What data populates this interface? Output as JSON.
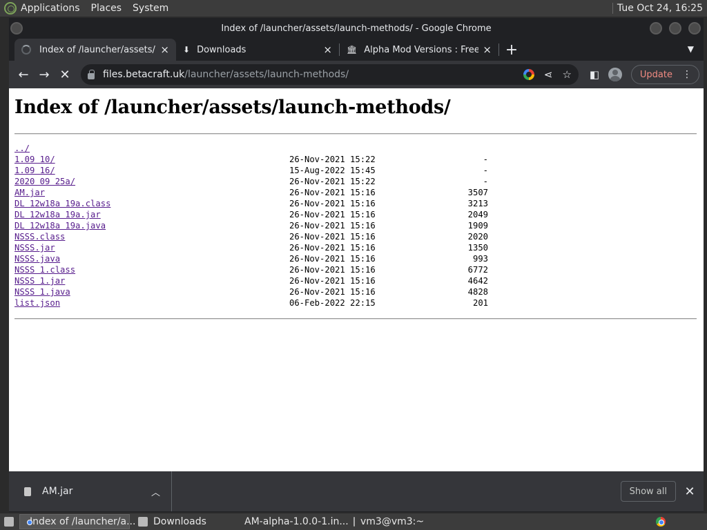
{
  "top_panel": {
    "menus": [
      "Applications",
      "Places",
      "System"
    ],
    "clock": "Tue Oct 24, 16:25"
  },
  "window": {
    "title": "Index of /launcher/assets/launch-methods/ - Google Chrome"
  },
  "tabs": [
    {
      "title": "Index of /launcher/assets/launch-methods/",
      "close": "×"
    },
    {
      "title": "Downloads",
      "close": "×"
    },
    {
      "title": "Alpha Mod Versions : Free Download",
      "close": "×"
    }
  ],
  "new_tab": "+",
  "address_bar": {
    "host": "files.betacraft.uk",
    "path": "/launcher/assets/launch-methods/"
  },
  "update_button": "Update",
  "page": {
    "heading": "Index of /launcher/assets/launch-methods/",
    "parent_link": "../",
    "entries": [
      {
        "name": "1.09 10/",
        "date": "26-Nov-2021 15:22",
        "size": "-"
      },
      {
        "name": "1.09 16/",
        "date": "15-Aug-2022 15:45",
        "size": "-"
      },
      {
        "name": "2020 09 25a/",
        "date": "26-Nov-2021 15:22",
        "size": "-"
      },
      {
        "name": "AM.jar",
        "date": "26-Nov-2021 15:16",
        "size": "3507"
      },
      {
        "name": "DL 12w18a 19a.class",
        "date": "26-Nov-2021 15:16",
        "size": "3213"
      },
      {
        "name": "DL 12w18a 19a.jar",
        "date": "26-Nov-2021 15:16",
        "size": "2049"
      },
      {
        "name": "DL 12w18a 19a.java",
        "date": "26-Nov-2021 15:16",
        "size": "1909"
      },
      {
        "name": "NSSS.class",
        "date": "26-Nov-2021 15:16",
        "size": "2020"
      },
      {
        "name": "NSSS.jar",
        "date": "26-Nov-2021 15:16",
        "size": "1350"
      },
      {
        "name": "NSSS.java",
        "date": "26-Nov-2021 15:16",
        "size": "993"
      },
      {
        "name": "NSSS 1.class",
        "date": "26-Nov-2021 15:16",
        "size": "6772"
      },
      {
        "name": "NSSS 1.jar",
        "date": "26-Nov-2021 15:16",
        "size": "4642"
      },
      {
        "name": "NSSS 1.java",
        "date": "26-Nov-2021 15:16",
        "size": "4828"
      },
      {
        "name": "list.json",
        "date": "06-Feb-2022 22:15",
        "size": "201"
      }
    ]
  },
  "download_shelf": {
    "file_name": "AM.jar",
    "show_all": "Show all"
  },
  "taskbar": [
    {
      "label": "Index of /launcher/a...",
      "icon": "chrome-icon",
      "active": true
    },
    {
      "label": "Downloads",
      "icon": "folder-icon",
      "active": false
    },
    {
      "label": "AM-alpha-1.0.0-1.in...",
      "icon": "text-editor-icon",
      "active": false
    },
    {
      "label": "vm3@vm3:~",
      "icon": "terminal-icon",
      "active": false
    }
  ]
}
